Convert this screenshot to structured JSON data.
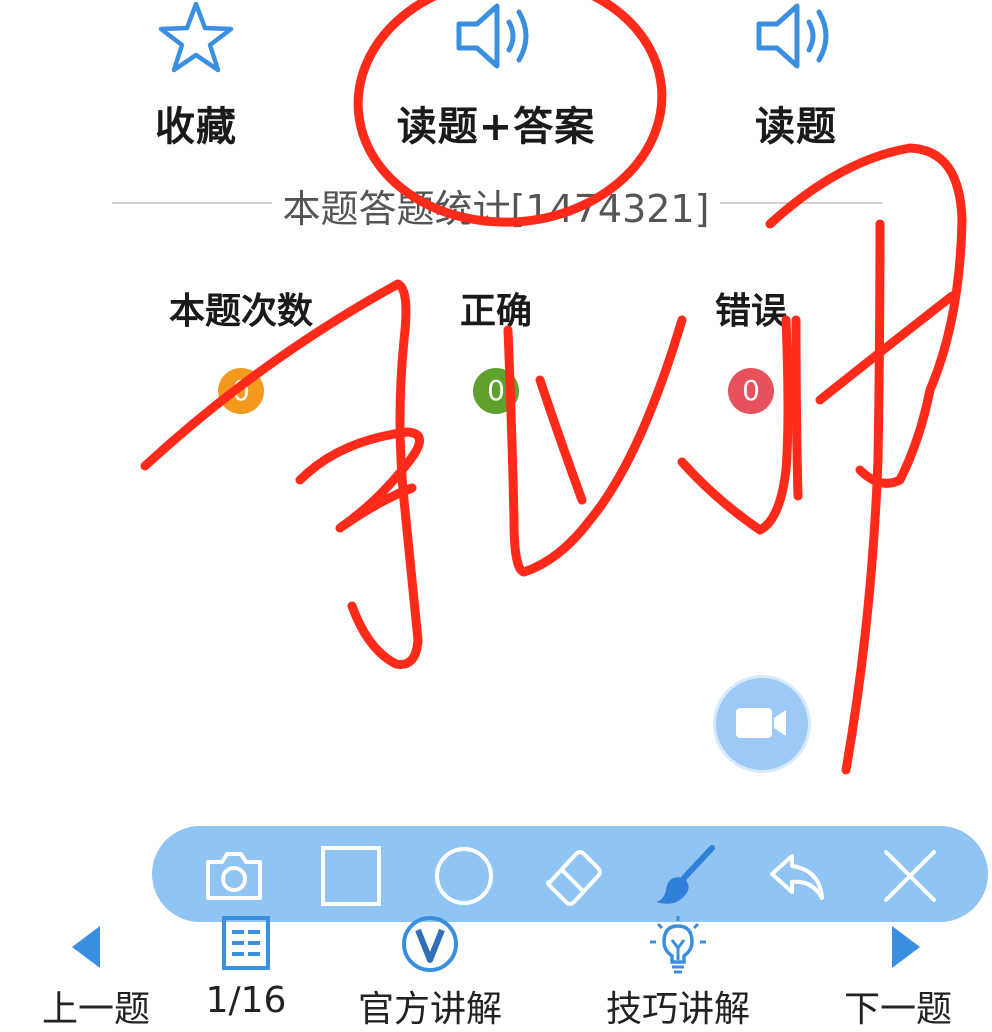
{
  "top_actions": {
    "favorite": {
      "label": "收藏",
      "icon": "star-icon"
    },
    "read_question_answer": {
      "label": "读题+答案",
      "icon": "speaker-icon"
    },
    "read_question": {
      "label": "读题",
      "icon": "speaker-icon"
    }
  },
  "stats": {
    "title": "本题答题统计[1474321]",
    "columns": [
      {
        "label": "本题次数",
        "value": "0",
        "color": "#f39a1e"
      },
      {
        "label": "正确",
        "value": "0",
        "color": "#5ea12c"
      },
      {
        "label": "错误",
        "value": "0",
        "color": "#e8505b"
      }
    ]
  },
  "video_button": {
    "icon": "video-camera-icon"
  },
  "draw_toolbar": {
    "background": "#8fc4f3",
    "tools": [
      {
        "name": "camera",
        "icon": "camera-icon"
      },
      {
        "name": "rectangle",
        "icon": "square-icon"
      },
      {
        "name": "circle",
        "icon": "circle-icon"
      },
      {
        "name": "eraser",
        "icon": "eraser-icon"
      },
      {
        "name": "brush",
        "icon": "brush-icon"
      },
      {
        "name": "undo",
        "icon": "undo-arrow-icon"
      },
      {
        "name": "close",
        "icon": "close-icon"
      }
    ]
  },
  "bottom_nav": {
    "prev": {
      "label": "上一题",
      "icon": "triangle-left-icon"
    },
    "progress": {
      "label": "1/16",
      "icon": "list-icon"
    },
    "official": {
      "label": "官方讲解",
      "icon": "v-badge-icon"
    },
    "tips": {
      "label": "技巧讲解",
      "icon": "lightbulb-icon"
    },
    "next": {
      "label": "下一题",
      "icon": "triangle-right-icon"
    }
  },
  "accent_color": "#3a8fe0",
  "annotation_color": "#ff2a1a"
}
